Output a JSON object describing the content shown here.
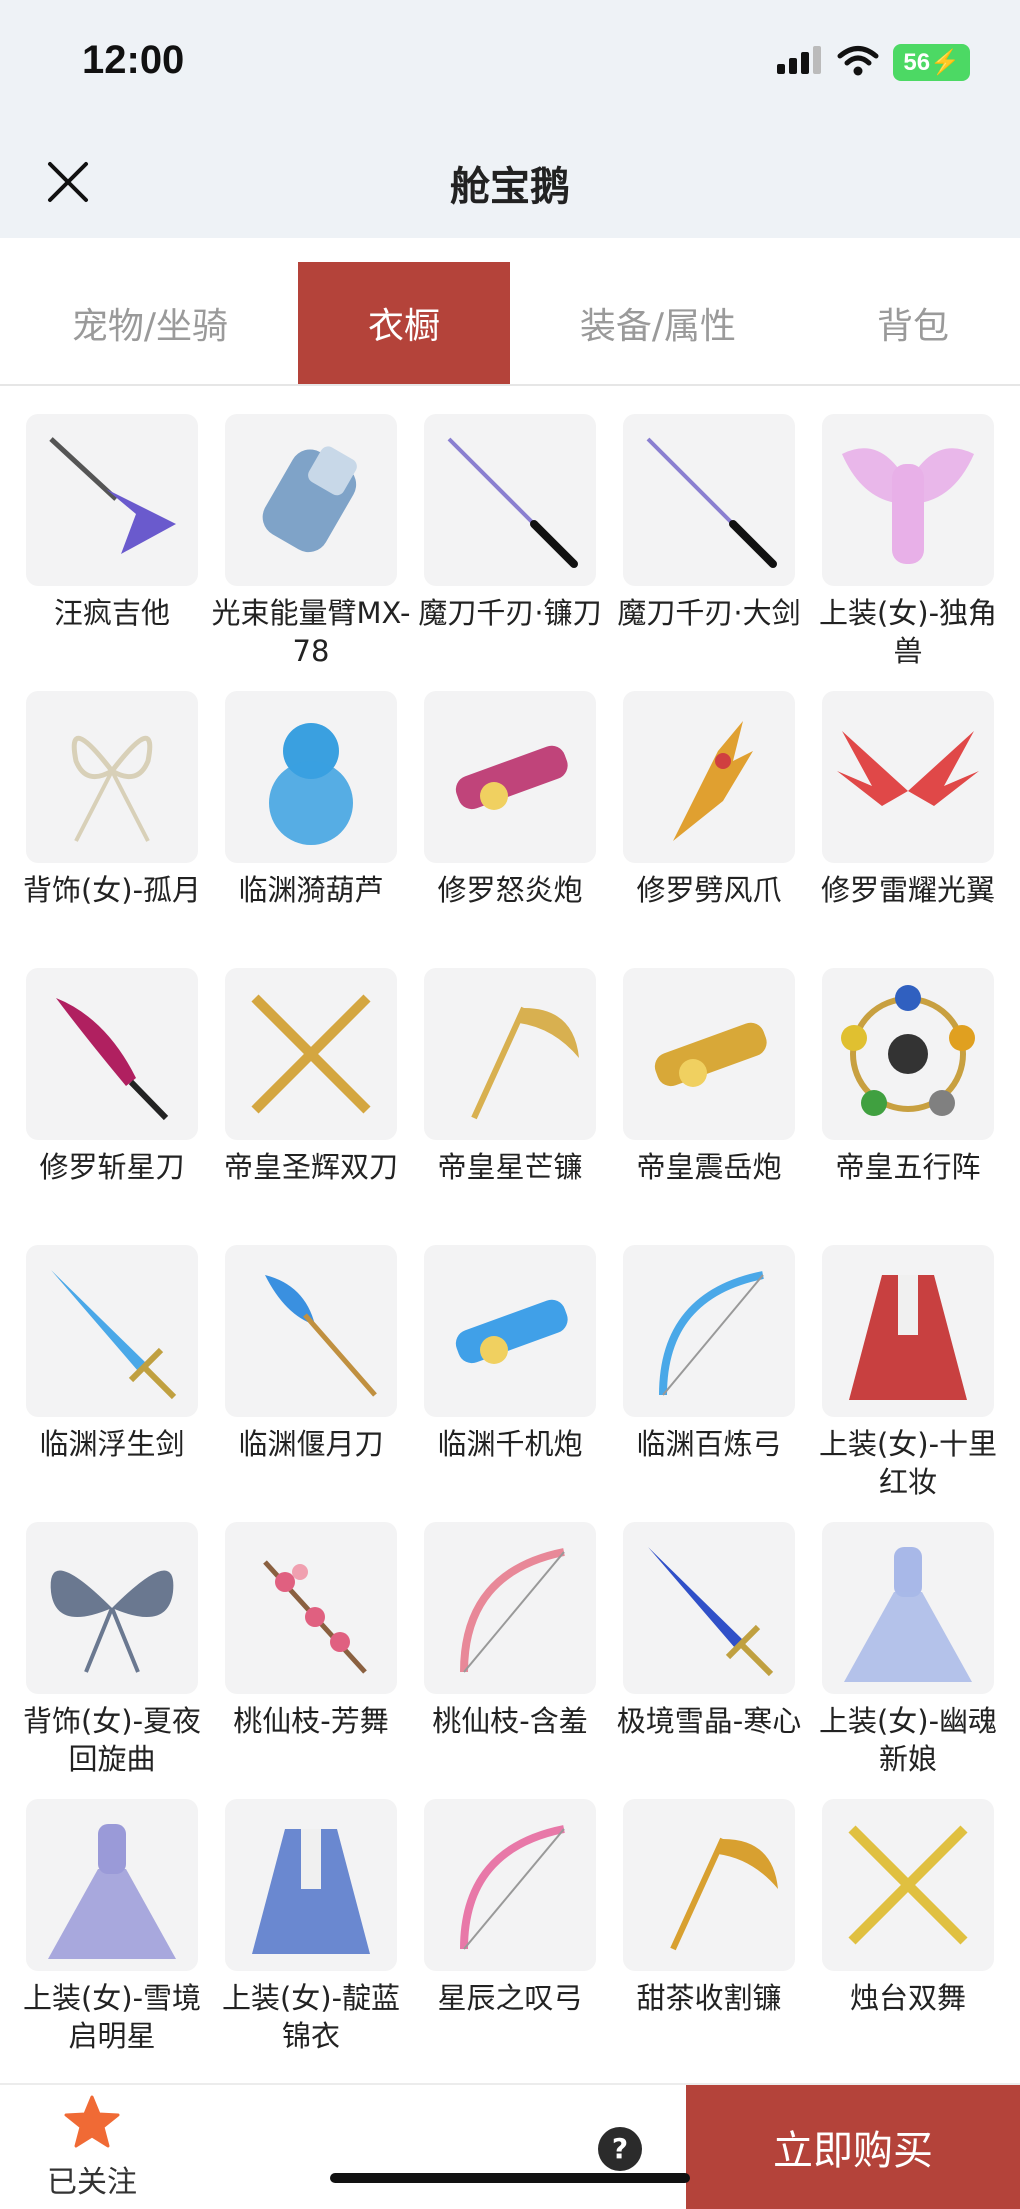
{
  "status": {
    "time": "12:00",
    "battery": "56"
  },
  "header": {
    "title": "舱宝鹅"
  },
  "tabs": [
    {
      "label": "宠物/坐骑"
    },
    {
      "label": "衣橱"
    },
    {
      "label": "装备/属性"
    },
    {
      "label": "背包"
    }
  ],
  "active_tab": "衣橱",
  "items": [
    {
      "name": "汪疯吉他",
      "icon": "guitar-icon",
      "color": "#6a5acd"
    },
    {
      "name": "光束能量臂MX-78",
      "icon": "arm-cannon-icon",
      "color": "#7fa3c8"
    },
    {
      "name": "魔刀千刃·镰刀",
      "icon": "katana-icon",
      "color": "#8a7fd0"
    },
    {
      "name": "魔刀千刃·大剑",
      "icon": "katana-icon",
      "color": "#8a7fd0"
    },
    {
      "name": "上装(女)-独角兽",
      "icon": "winged-outfit-icon",
      "color": "#e07be0"
    },
    {
      "name": "背饰(女)-孤月",
      "icon": "ribbon-icon",
      "color": "#d8d0b8"
    },
    {
      "name": "临渊漪葫芦",
      "icon": "gourd-icon",
      "color": "#3aa0e0"
    },
    {
      "name": "修罗怒炎炮",
      "icon": "cannon-icon",
      "color": "#c0447a"
    },
    {
      "name": "修罗劈风爪",
      "icon": "claw-icon",
      "color": "#e0a030"
    },
    {
      "name": "修罗雷耀光翼",
      "icon": "wings-icon",
      "color": "#e04848"
    },
    {
      "name": "修罗斩星刀",
      "icon": "blade-icon",
      "color": "#b02060"
    },
    {
      "name": "帝皇圣辉双刀",
      "icon": "twin-blades-icon",
      "color": "#d4a640"
    },
    {
      "name": "帝皇星芒镰",
      "icon": "scythe-icon",
      "color": "#d8b050"
    },
    {
      "name": "帝皇震岳炮",
      "icon": "cannon-icon",
      "color": "#d8a838"
    },
    {
      "name": "帝皇五行阵",
      "icon": "orb-ring-icon",
      "color": "#3060c0"
    },
    {
      "name": "临渊浮生剑",
      "icon": "sword-icon",
      "color": "#4aa8e8"
    },
    {
      "name": "临渊偃月刀",
      "icon": "glaive-icon",
      "color": "#3a90e0"
    },
    {
      "name": "临渊千机炮",
      "icon": "cannon-icon",
      "color": "#40a0e8"
    },
    {
      "name": "临渊百炼弓",
      "icon": "bow-icon",
      "color": "#4aa8e8"
    },
    {
      "name": "上装(女)-十里红妆",
      "icon": "robe-icon",
      "color": "#c84040"
    },
    {
      "name": "背饰(女)-夏夜回旋曲",
      "icon": "butterfly-wings-icon",
      "color": "#6a7890"
    },
    {
      "name": "桃仙枝-芳舞",
      "icon": "branch-icon",
      "color": "#e06080"
    },
    {
      "name": "桃仙枝-含羞",
      "icon": "bow-icon",
      "color": "#e88898"
    },
    {
      "name": "极境雪晶-寒心",
      "icon": "sword-icon",
      "color": "#3050c8"
    },
    {
      "name": "上装(女)-幽魂新娘",
      "icon": "dress-icon",
      "color": "#a8b8e8"
    },
    {
      "name": "上装(女)-雪境启明星",
      "icon": "dress-icon",
      "color": "#9a9ad8"
    },
    {
      "name": "上装(女)-靛蓝锦衣",
      "icon": "robe-icon",
      "color": "#6a88d0"
    },
    {
      "name": "星辰之叹弓",
      "icon": "bow-icon",
      "color": "#e878a8"
    },
    {
      "name": "甜茶收割镰",
      "icon": "scythe-icon",
      "color": "#d8a030"
    },
    {
      "name": "烛台双舞",
      "icon": "twin-blades-icon",
      "color": "#e0c040"
    }
  ],
  "bottom": {
    "follow_label": "已关注",
    "buy_label": "立即购买",
    "help": "?"
  },
  "colors": {
    "accent": "#b4433a",
    "star": "#f06a35"
  }
}
